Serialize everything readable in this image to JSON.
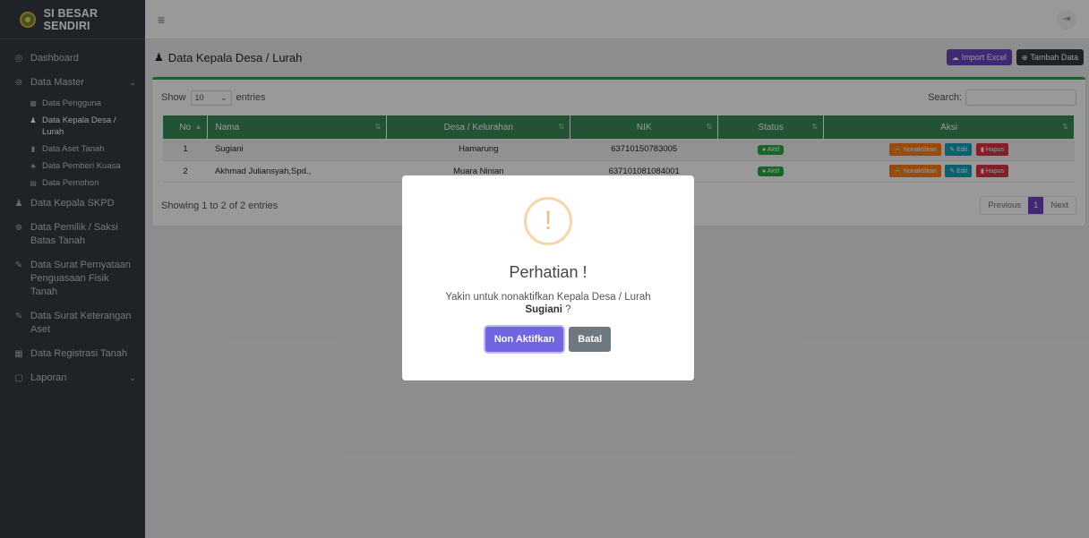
{
  "brand": {
    "name": "SI BESAR SENDIRI"
  },
  "sidebar": {
    "items": [
      {
        "label": "Dashboard",
        "icon": "dashboard-icon"
      },
      {
        "label": "Data Master",
        "icon": "database-icon"
      },
      {
        "label": "Data Kepala SKPD",
        "icon": "user-tie-icon"
      },
      {
        "label": "Data Pemilik / Saksi Batas Tanah",
        "icon": "users-icon"
      },
      {
        "label": "Data Surat Pernyataan Penguasaan Fisik Tanah",
        "icon": "file-signature-icon"
      },
      {
        "label": "Data Surat Keterangan Aset",
        "icon": "file-signature-icon"
      },
      {
        "label": "Data Registrasi Tanah",
        "icon": "table-icon"
      },
      {
        "label": "Laporan",
        "icon": "file-icon"
      }
    ],
    "submenu": [
      {
        "label": "Data Pengguna"
      },
      {
        "label": "Data Kepala Desa / Lurah"
      },
      {
        "label": "Data Aset Tanah"
      },
      {
        "label": "Data Pemberi Kuasa"
      },
      {
        "label": "Data Pemohon"
      }
    ]
  },
  "page": {
    "title": "Data Kepala Desa / Lurah"
  },
  "toolbar": {
    "import_label": "Import Excel",
    "add_label": "Tambah Data"
  },
  "datatable": {
    "show_label": "Show",
    "length_value": "10",
    "entries_label": "entries",
    "search_label": "Search:",
    "info": "Showing 1 to 2 of 2 entries",
    "prev_label": "Previous",
    "current_page": "1",
    "next_label": "Next"
  },
  "table": {
    "headers": [
      "No",
      "Nama",
      "Desa / Kelurahan",
      "NIK",
      "Status",
      "Aksi"
    ],
    "rows": [
      {
        "no": "1",
        "nama": "Sugiani",
        "desa": "Hamarung",
        "nik": "63710150783005",
        "status": "Aktif"
      },
      {
        "no": "2",
        "nama": "Akhmad Juliansyah,Spd.,",
        "desa": "Muara Ninian",
        "nik": "637101081084001",
        "status": "Aktif"
      }
    ],
    "actions": {
      "nonaktif": "Nonaktifkan",
      "edit": "Edit",
      "hapus": "Hapus"
    }
  },
  "modal": {
    "icon_glyph": "!",
    "title": "Perhatian !",
    "text": "Yakin untuk nonaktifkan Kepala Desa / Lurah",
    "name": "Sugiani",
    "suffix": " ?",
    "confirm_label": "Non Aktifkan",
    "cancel_label": "Batal"
  },
  "colors": {
    "sidebar_bg": "#343a40",
    "table_header": "#3a8a57",
    "primary": "#6f42c1",
    "confirm": "#7066e0",
    "warning_icon": "#f8bb86"
  }
}
